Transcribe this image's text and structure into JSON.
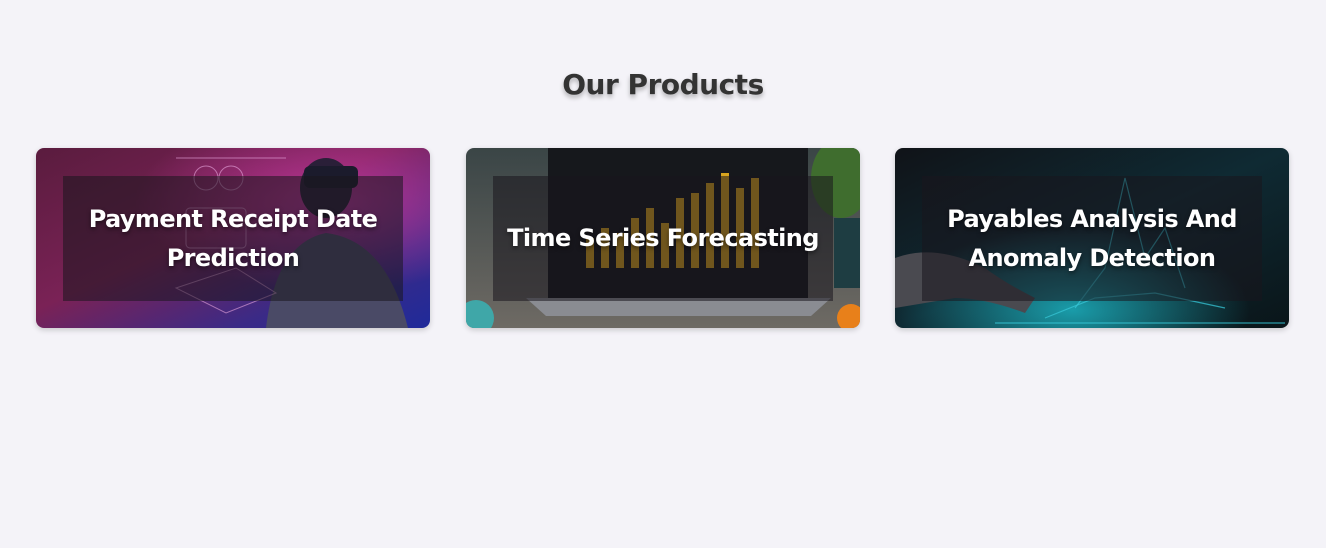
{
  "section": {
    "title": "Our Products"
  },
  "products": [
    {
      "title": "Payment Receipt Date Prediction",
      "image_icon": "vr-headset-image-icon"
    },
    {
      "title": "Time Series Forecasting",
      "image_icon": "laptop-chart-image-icon"
    },
    {
      "title": "Payables Analysis And Anomaly Detection",
      "image_icon": "hand-data-graph-image-icon"
    }
  ],
  "colors": {
    "page_background": "#f4f3f8",
    "title_text": "#333333",
    "card_text": "#ffffff"
  }
}
